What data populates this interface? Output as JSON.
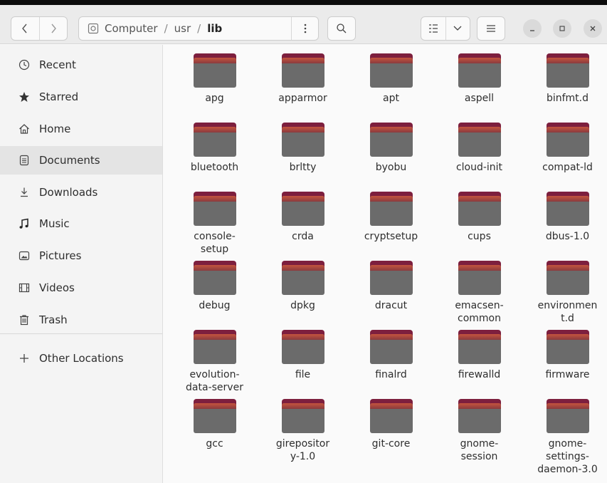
{
  "toolbar": {
    "back_icon": "chevron-left",
    "forward_icon": "chevron-right",
    "path": [
      "Computer",
      "usr",
      "lib"
    ],
    "separators": [
      "/",
      "/"
    ],
    "path_menu_icon": "vertical-ellipsis",
    "search_icon": "magnifier",
    "view_icon": "list-view",
    "view_dropdown_icon": "chevron-down",
    "menu_icon": "hamburger",
    "window_controls": [
      "minimize",
      "maximize",
      "close"
    ]
  },
  "sidebar": {
    "items": [
      {
        "label": "Recent",
        "icon": "clock"
      },
      {
        "label": "Starred",
        "icon": "star"
      },
      {
        "label": "Home",
        "icon": "home"
      },
      {
        "label": "Documents",
        "icon": "document"
      },
      {
        "label": "Downloads",
        "icon": "download"
      },
      {
        "label": "Music",
        "icon": "music-note"
      },
      {
        "label": "Pictures",
        "icon": "picture"
      },
      {
        "label": "Videos",
        "icon": "film"
      },
      {
        "label": "Trash",
        "icon": "trash"
      }
    ],
    "other_locations": {
      "label": "Other Locations",
      "icon": "plus"
    },
    "active_index": 3
  },
  "folders": [
    "apg",
    "apparmor",
    "apt",
    "aspell",
    "binfmt.d",
    "bluetooth",
    "brltty",
    "byobu",
    "cloud-init",
    "compat-ld",
    "console-setup",
    "crda",
    "cryptsetup",
    "cups",
    "dbus-1.0",
    "debug",
    "dpkg",
    "dracut",
    "emacsen-common",
    "environment.d",
    "evolution-data-server",
    "file",
    "finalrd",
    "firewalld",
    "firmware",
    "gcc",
    "girepository-1.0",
    "git-core",
    "gnome-session",
    "gnome-settings-daemon-3.0"
  ],
  "folder_labels_display": [
    [
      "apg"
    ],
    [
      "apparmor"
    ],
    [
      "apt"
    ],
    [
      "aspell"
    ],
    [
      "binfmt.d"
    ],
    [
      "bluetooth"
    ],
    [
      "brltty"
    ],
    [
      "byobu"
    ],
    [
      "cloud-init"
    ],
    [
      "compat-ld"
    ],
    [
      "console-",
      "setup"
    ],
    [
      "crda"
    ],
    [
      "cryptsetup"
    ],
    [
      "cups"
    ],
    [
      "dbus-1.0"
    ],
    [
      "debug"
    ],
    [
      "dpkg"
    ],
    [
      "dracut"
    ],
    [
      "emacsen-",
      "common"
    ],
    [
      "environmen",
      "t.d"
    ],
    [
      "evolution-",
      "data-server"
    ],
    [
      "file"
    ],
    [
      "finalrd"
    ],
    [
      "firewalld"
    ],
    [
      "firmware"
    ],
    [
      "gcc"
    ],
    [
      "girepositor",
      "y-1.0"
    ],
    [
      "git-core"
    ],
    [
      "gnome-",
      "session"
    ],
    [
      "gnome-",
      "settings-",
      "daemon-3.0"
    ]
  ],
  "colors": {
    "folder_tab": "#7d1f3e",
    "folder_body": "#6b6b6b",
    "folder_accent": "#c4543e",
    "sidebar_bg": "#f4f4f4",
    "active_bg": "#e4e4e4"
  }
}
